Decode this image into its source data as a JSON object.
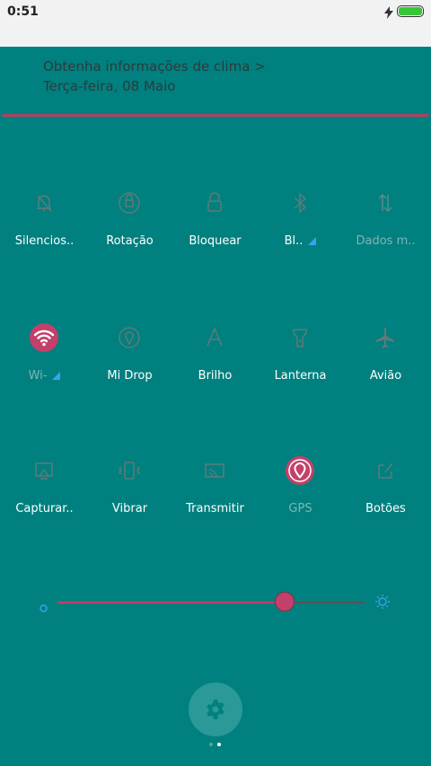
{
  "status_bar": {
    "time": "0:51",
    "battery_icon": "battery-full-icon",
    "charging_icon": "bolt-icon"
  },
  "header": {
    "weather_link": "Obtenha informações de clima >",
    "date": "Terça-feira, 08 Maio"
  },
  "tiles": [
    {
      "label": "Silencios..",
      "icon": "bell-off-icon"
    },
    {
      "label": "Rotação",
      "icon": "rotation-lock-icon"
    },
    {
      "label": "Bloquear",
      "icon": "lock-icon"
    },
    {
      "label": "Bl..",
      "icon": "bluetooth-icon",
      "expandable": true
    },
    {
      "label": "Dados m..",
      "icon": "mobile-data-icon"
    },
    {
      "label": "Wi-",
      "icon": "wifi-icon",
      "active": true,
      "expandable": true
    },
    {
      "label": "Mi Drop",
      "icon": "mi-drop-icon"
    },
    {
      "label": "Brilho",
      "icon": "auto-brightness-icon"
    },
    {
      "label": "Lanterna",
      "icon": "flashlight-icon"
    },
    {
      "label": "Avião",
      "icon": "airplane-icon"
    },
    {
      "label": "Capturar..",
      "icon": "screenshot-icon"
    },
    {
      "label": "Vibrar",
      "icon": "vibrate-icon"
    },
    {
      "label": "Transmitir",
      "icon": "cast-icon"
    },
    {
      "label": "GPS",
      "icon": "gps-icon",
      "active": true
    },
    {
      "label": "Botões",
      "icon": "buttons-icon"
    }
  ],
  "brightness": {
    "level_percent": 74,
    "low_icon": "brightness-low-icon",
    "high_icon": "brightness-high-icon"
  },
  "settings": {
    "icon": "gear-icon"
  },
  "pager": {
    "pages": 2,
    "current": 2
  },
  "colors": {
    "background": "#00807f",
    "accent": "#c2416a",
    "highlight": "#3aa3e8"
  }
}
